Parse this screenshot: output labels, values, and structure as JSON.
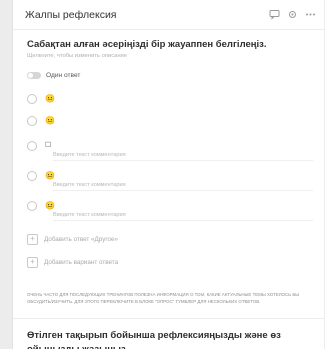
{
  "header": {
    "title": "Жалпы рефлексия",
    "icons": [
      "chat-icon",
      "settings-icon",
      "more-icon"
    ]
  },
  "question": {
    "title": "Сабақтан алған әсеріңізді бір жауаппен белгілеңіз.",
    "hint": "Щелкните, чтобы изменить описание",
    "toggle_label": "Один ответ",
    "toggle_on": false,
    "options": [
      {
        "type": "emoji",
        "value": "😐",
        "comment": ""
      },
      {
        "type": "emoji",
        "value": "😐",
        "comment": ""
      },
      {
        "type": "box",
        "value": "☐",
        "comment": "Введите текст комментария"
      },
      {
        "type": "emoji",
        "value": "😐",
        "comment": "Введите текст комментария"
      },
      {
        "type": "emoji",
        "value": "😐",
        "comment": "Введите текст комментария"
      }
    ],
    "add_other": "Добавить ответ «Другое»",
    "add_option": "Добавить вариант ответа"
  },
  "note": "Очень часто для последующих тренингов полезна информация о том, какие актуальные темы хотелось бы обсудить/изучить. Для этого переключите в блоке \"Опрос\" тумблер для нескольких ответов.",
  "question2": {
    "title": "Өтілген тақырып бойынша рефлексияңызды және өз ойыңызды жазыңыз"
  },
  "colors": {
    "background": "#ececec",
    "card": "#ffffff",
    "emoji": "#e0a800"
  }
}
